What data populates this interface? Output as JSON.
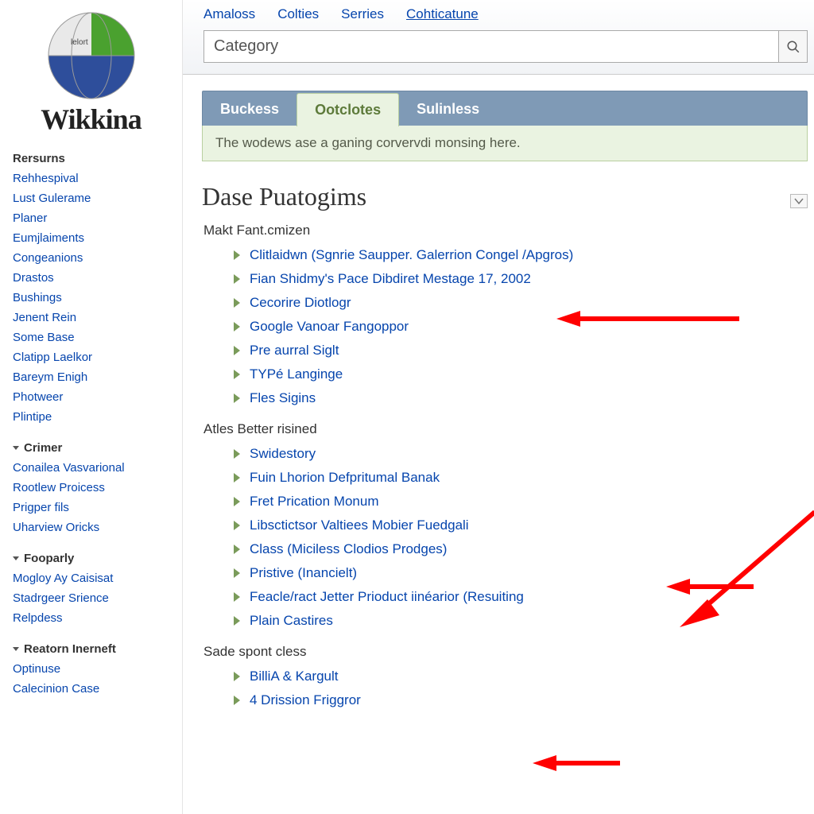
{
  "logo": {
    "text": "Wikkina"
  },
  "search": {
    "value": "Category"
  },
  "topnav": [
    {
      "label": "Amaloss",
      "underlined": false
    },
    {
      "label": "Colties",
      "underlined": false
    },
    {
      "label": "Serries",
      "underlined": false
    },
    {
      "label": "Cohticatune",
      "underlined": true
    }
  ],
  "sidebar": {
    "sections": [
      {
        "heading": "Rersurns",
        "caret": false,
        "items": [
          "Rehhespival",
          "Lust Gulerame",
          "Planer",
          "Eumjlaiments",
          "Congeanions",
          "Drastos",
          "Bushings",
          "Jenent Rein",
          "Some Base",
          "Clatipp Laelkor",
          "Bareym Enigh",
          "Photweer",
          "Plintipe"
        ]
      },
      {
        "heading": "Crimer",
        "caret": true,
        "items": [
          "Conailea Vasvarional",
          "Rootlew Proicess",
          "Prigper fils",
          "Uharview Oricks"
        ]
      },
      {
        "heading": "Fooparly",
        "caret": true,
        "items": [
          "Mogloy Ay Caisisat",
          "Stadrgeer Srience",
          "Relpdess"
        ]
      },
      {
        "heading": "Reatorn Inerneft",
        "caret": true,
        "items": [
          "Optinuse",
          "Calecinion Case"
        ]
      }
    ]
  },
  "pagetabs": [
    {
      "label": "Buckess",
      "active": false
    },
    {
      "label": "Ootclotes",
      "active": true
    },
    {
      "label": "Sulinless",
      "active": false
    }
  ],
  "notice": "The wodews ase a ganing corvervdi monsing here.",
  "page_title": "Dase Puatogims",
  "sections": [
    {
      "heading": "Makt Fant.cmizen",
      "items": [
        "Clitlaidwn (Sgnrie Saupper. Galerrion Congel /Apgros)",
        "Fian Shidmy's Pace Dibdiret Mestage 17, 2002",
        "Cecorire Diotlogr",
        "Google Vanoar Fangoppor",
        "Pre aurral Siglt",
        "TYPé Langinge",
        "Fles Sigins"
      ]
    },
    {
      "heading": "Atles Better risined",
      "items": [
        "Swidestory",
        "Fuin Lhorion Defpritumal Banak",
        "Fret Prication Monum",
        "Libsctictsor Valtiees Mobier Fuedgali",
        "Class (Miciless Clodios Prodges)",
        "Pristive (Inancielt)",
        "Feacle/ract Jetter Prioduct iinéarior (Resuiting",
        "Plain Castires"
      ]
    },
    {
      "heading": "Sade spont cless",
      "items": [
        "BilliA & Kargult",
        "4 Drission Friggror"
      ]
    }
  ]
}
